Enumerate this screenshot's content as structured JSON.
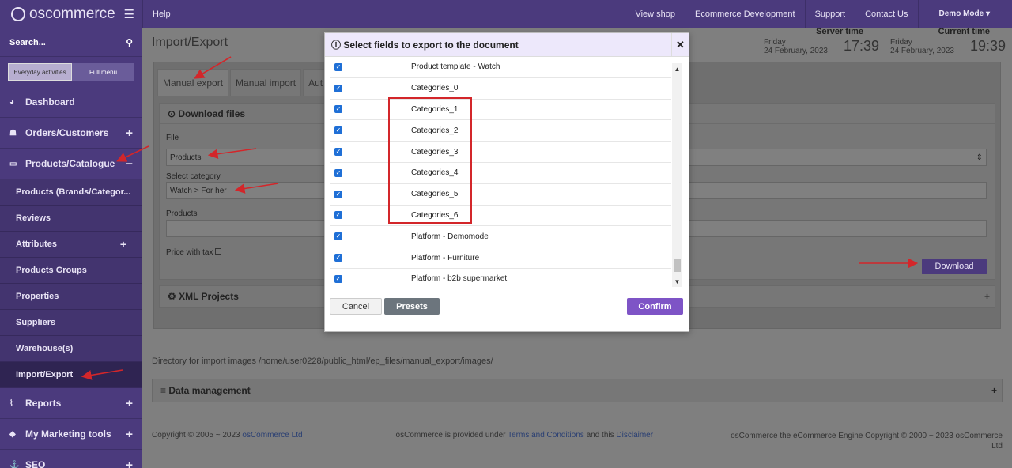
{
  "brand": {
    "name": "oscommerce"
  },
  "sidebar": {
    "search_label": "Search...",
    "toggle": {
      "everyday": "Everyday activities",
      "full": "Full menu"
    },
    "items": [
      {
        "label": "Dashboard"
      },
      {
        "label": "Orders/Customers"
      },
      {
        "label": "Products/Catalogue"
      },
      {
        "label": "Reports"
      },
      {
        "label": "My Marketing tools"
      },
      {
        "label": "SEO"
      }
    ],
    "sub": [
      {
        "label": "Products (Brands/Categor..."
      },
      {
        "label": "Reviews"
      },
      {
        "label": "Attributes"
      },
      {
        "label": "Products Groups"
      },
      {
        "label": "Properties"
      },
      {
        "label": "Suppliers"
      },
      {
        "label": "Warehouse(s)"
      },
      {
        "label": "Import/Export"
      }
    ]
  },
  "topbar": {
    "help": "Help",
    "links": [
      "View shop",
      "Ecommerce Development",
      "Support",
      "Contact Us"
    ],
    "user": "Demo Mode"
  },
  "page": {
    "title": "Import/Export",
    "server_time": {
      "label": "Server time",
      "day": "Friday",
      "date": "24 February, 2023",
      "time": "17:39"
    },
    "current_time": {
      "label": "Current time",
      "day": "Friday",
      "date": "24 February, 2023",
      "time": "19:39"
    },
    "tabs": [
      "Manual export",
      "Manual import",
      "Aut"
    ],
    "download_files": "Download files",
    "file_label": "File",
    "file_value": "Products",
    "category_label": "Select category",
    "category_value": "Watch > For her",
    "products_label": "Products",
    "price_tax_label": "Price with tax",
    "download_btn": "Download",
    "xml_projects": "XML Projects",
    "directory_line": "Directory for import images /home/user0228/public_html/ep_files/manual_export/images/",
    "data_management": "Data management",
    "footer": {
      "copyright": "Copyright © 2005 ~ 2023 ",
      "copyright_link": "osCommerce Ltd",
      "center_pre": "osCommerce is provided under ",
      "terms": "Terms and Conditions",
      "center_mid": " and this ",
      "disclaimer": "Disclaimer",
      "right": "osCommerce the eCommerce Engine Copyright © 2000 ~ 2023 osCommerce Ltd"
    }
  },
  "modal": {
    "title": "Select fields to export to the document",
    "fields": [
      "Product template - Watch",
      "Categories_0",
      "Categories_1",
      "Categories_2",
      "Categories_3",
      "Categories_4",
      "Categories_5",
      "Categories_6",
      "Platform - Demomode",
      "Platform - Furniture",
      "Platform - b2b supermarket"
    ],
    "cancel": "Cancel",
    "presets": "Presets",
    "confirm": "Confirm"
  },
  "colors": {
    "accent": "#4b3a7d",
    "confirm": "#7e54c6",
    "highlight": "#d3262a"
  }
}
